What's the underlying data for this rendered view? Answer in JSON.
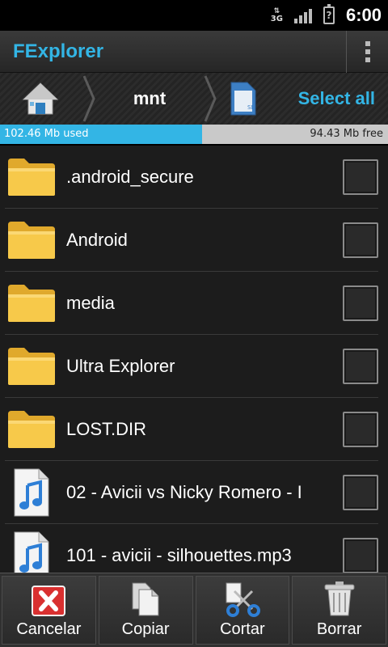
{
  "status_bar": {
    "network": "3G",
    "time": "6:00",
    "battery_symbol": "?"
  },
  "app": {
    "title": "FExplorer",
    "menu_icon": "overflow-menu-icon"
  },
  "breadcrumb": {
    "home_icon": "home-icon",
    "current_folder": "mnt",
    "sd_icon": "sd-card-icon",
    "select_all_label": "Select all"
  },
  "storage": {
    "used_label": "102.46 Mb used",
    "free_label": "94.43 Mb free",
    "used_fraction": 0.52
  },
  "files": [
    {
      "name": ".android_secure",
      "type": "folder",
      "icon": "folder-icon"
    },
    {
      "name": "Android",
      "type": "folder",
      "icon": "folder-icon"
    },
    {
      "name": "media",
      "type": "folder",
      "icon": "folder-icon"
    },
    {
      "name": "Ultra Explorer",
      "type": "folder",
      "icon": "folder-icon"
    },
    {
      "name": "LOST.DIR",
      "type": "folder",
      "icon": "folder-icon"
    },
    {
      "name": "02 - Avicii vs Nicky Romero - I",
      "type": "audio",
      "icon": "music-file-icon"
    },
    {
      "name": "101 - avicii - silhouettes.mp3",
      "type": "audio",
      "icon": "music-file-icon"
    }
  ],
  "toolbar": {
    "cancel_label": "Cancelar",
    "copy_label": "Copiar",
    "cut_label": "Cortar",
    "delete_label": "Borrar"
  },
  "colors": {
    "accent": "#33b5e5",
    "folder": "#f5c344",
    "cancel_red": "#d93030"
  }
}
